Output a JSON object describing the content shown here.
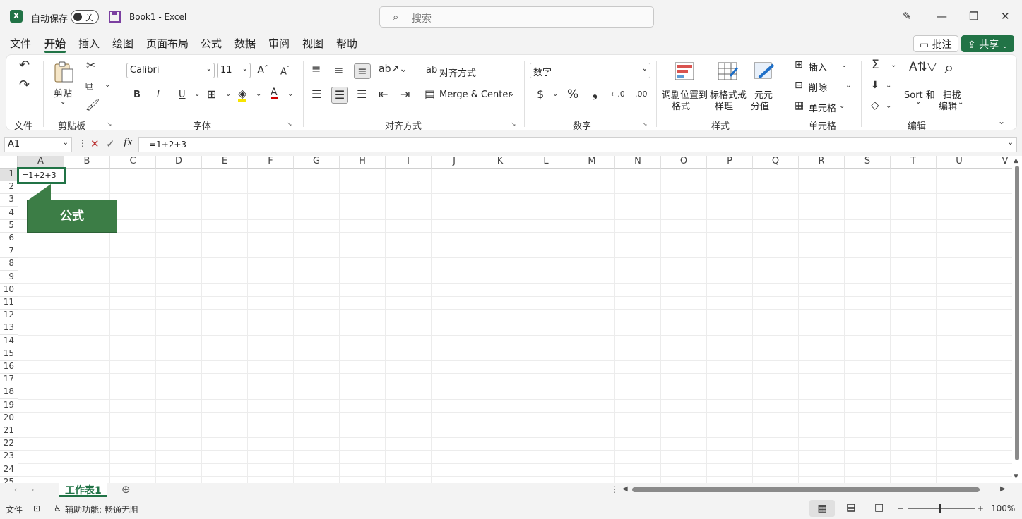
{
  "titlebar": {
    "autosave_label": "自动保存",
    "autosave_state": "关",
    "document_title": "Book1  -  Excel",
    "search_placeholder": "搜索"
  },
  "tabs": [
    "文件",
    "开始",
    "插入",
    "绘图",
    "页面布局",
    "公式",
    "数据",
    "审阅",
    "视图",
    "帮助"
  ],
  "active_tab": "开始",
  "top_right": {
    "comments": "批注",
    "share": "共享"
  },
  "ribbon": {
    "groups": {
      "file": "文件",
      "clipboard": "剪贴板",
      "font": "字体",
      "alignment": "对齐方式",
      "number": "数字",
      "styles": "样式",
      "cells": "单元格",
      "editing": "编辑"
    },
    "paste_label": "剪贴",
    "font_name": "Calibri",
    "font_size": "11",
    "wrap_text": "对齐方式",
    "merge_center": "Merge & Center",
    "number_format": "数字",
    "conditional_format": [
      "调剧位置到",
      "格式"
    ],
    "format_table": [
      "标格式戒",
      "样理"
    ],
    "cell_styles": [
      "元元",
      "分值"
    ],
    "insert": "插入",
    "delete": "削除",
    "format": "单元格",
    "sort_filter": "Sort 和",
    "find_select": [
      "扫拢",
      "编辑"
    ]
  },
  "formula_bar": {
    "name_box": "A1",
    "fx": "fx",
    "formula": "=1+2+3"
  },
  "grid": {
    "columns": [
      "A",
      "B",
      "C",
      "D",
      "E",
      "F",
      "G",
      "H",
      "I",
      "J",
      "K",
      "L",
      "M",
      "N",
      "O",
      "P",
      "Q",
      "R",
      "S",
      "T",
      "U",
      "V"
    ],
    "rows": [
      "1",
      "2",
      "3",
      "4",
      "5",
      "6",
      "7",
      "8",
      "9",
      "10",
      "11",
      "12",
      "13",
      "14",
      "15",
      "16",
      "17",
      "18",
      "19",
      "20",
      "21",
      "22",
      "23",
      "24",
      "25"
    ],
    "a1_value": "=1+2+3",
    "callout": "公式"
  },
  "sheets": {
    "active": "工作表1"
  },
  "status": {
    "mode": "文件",
    "accessibility": "辅助功能: 畅通无阻",
    "zoom": "100%"
  },
  "colors": {
    "accent": "#217346",
    "callout": "#3c7d46"
  }
}
